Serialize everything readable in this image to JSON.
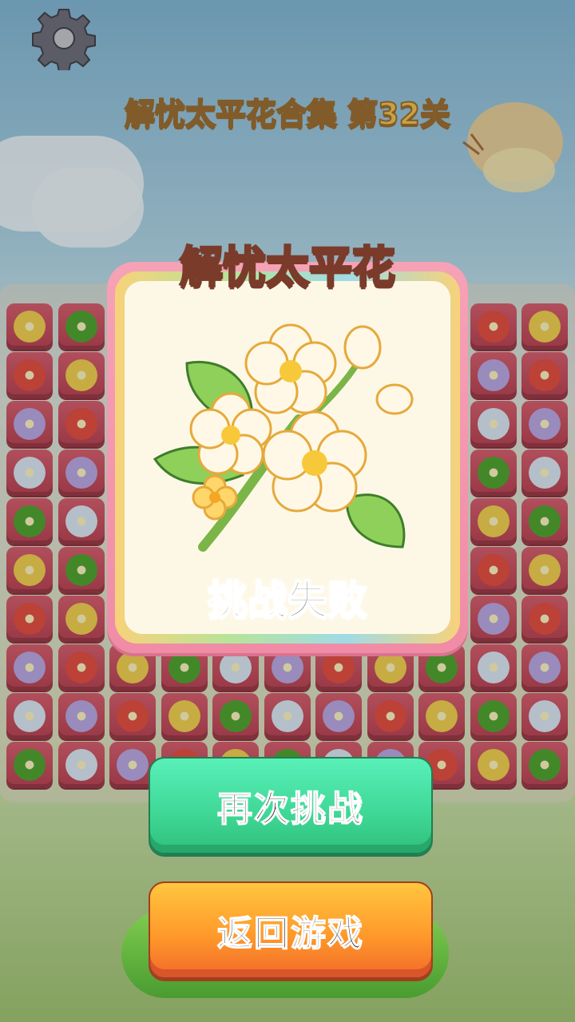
{
  "header": {
    "level_title": "解忧太平花合集  第32关",
    "settings_icon": "gear-icon"
  },
  "modal": {
    "title": "解忧太平花",
    "status_text": "挑战失败",
    "illustration": "white-flower-branch-icon"
  },
  "buttons": {
    "retry_label": "再次挑战",
    "back_label": "返回游戏"
  },
  "colors": {
    "tile": "#c84a5c",
    "modal_border": "#f39ab0",
    "retry_button": "#3fd795",
    "back_button": "#ff9a2a",
    "title_fill": "#f5c956"
  },
  "board": {
    "rows": 10,
    "cols": 11,
    "flower_colors": [
      "#f3d14b",
      "#b9a7e6",
      "#4aa32a",
      "#e6483a",
      "#dce9f6"
    ]
  }
}
